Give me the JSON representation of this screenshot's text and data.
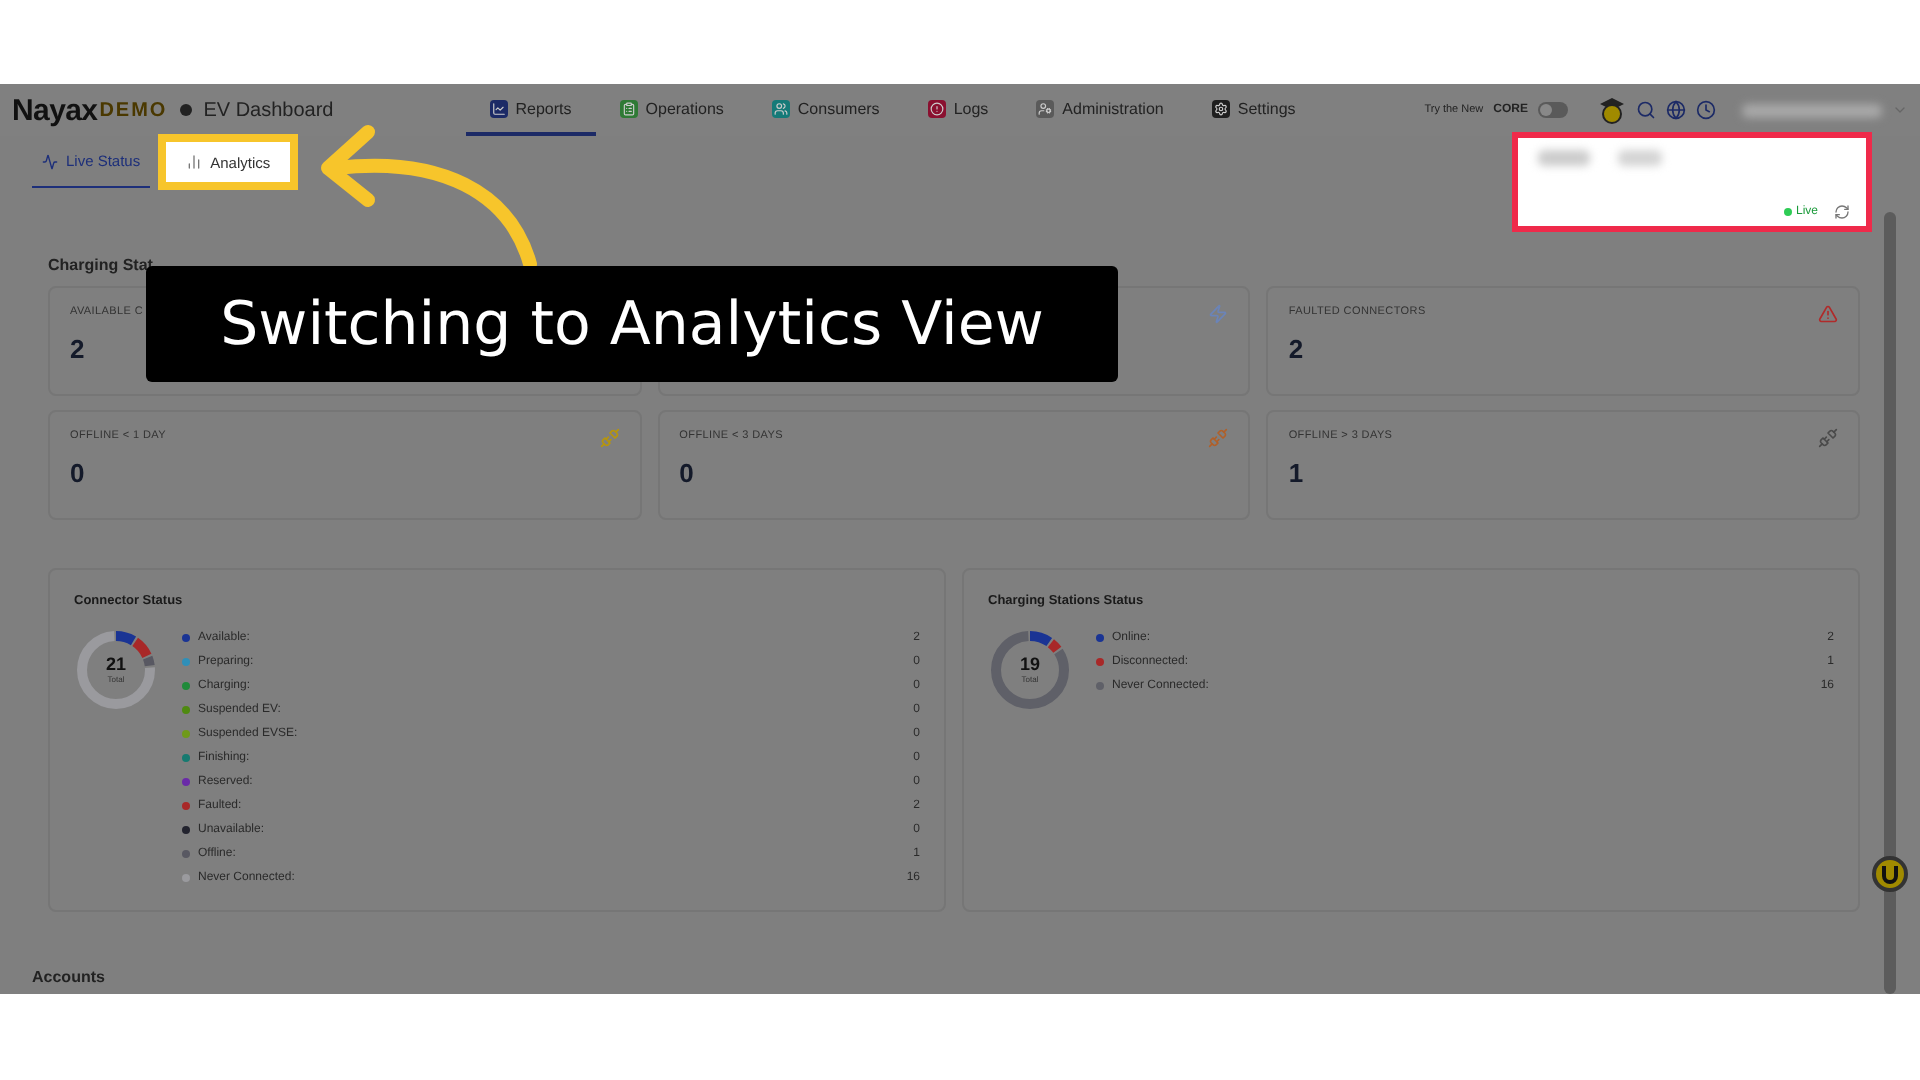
{
  "header": {
    "logo": "Nayax",
    "logo_badge": "DEMO",
    "app_title": "EV Dashboard",
    "nav": [
      {
        "label": "Reports",
        "color": "#1c2a66",
        "selected": true
      },
      {
        "label": "Operations",
        "color": "#2f7a35",
        "selected": false
      },
      {
        "label": "Consumers",
        "color": "#157a78",
        "selected": false
      },
      {
        "label": "Logs",
        "color": "#8a1030",
        "selected": false
      },
      {
        "label": "Administration",
        "color": "#5a5a5a",
        "selected": false
      },
      {
        "label": "Settings",
        "color": "#1e1e1e",
        "selected": false
      }
    ],
    "core_promo": {
      "prefix": "Try the New",
      "brand": "CORE",
      "on": false
    }
  },
  "tabs": [
    {
      "label": "Live Status",
      "selected": true,
      "highlighted": false
    },
    {
      "label": "Analytics",
      "selected": false,
      "highlighted": true
    }
  ],
  "status_panel": {
    "live_label": "Live",
    "highlighted": true
  },
  "section_title": "Charging Stat",
  "cards": [
    {
      "label": "AVAILABLE C",
      "value": "2",
      "kind": "plain"
    },
    {
      "kind": "bolt",
      "color": "#6b84b8"
    },
    {
      "label": "FAULTED CONNECTORS",
      "value": "2",
      "kind": "warning",
      "color": "#b02a2a"
    },
    {
      "label": "OFFLINE < 1 DAY",
      "value": "0",
      "kind": "offline",
      "color": "#b8960a"
    },
    {
      "label": "OFFLINE < 3 DAYS",
      "value": "0",
      "kind": "offline",
      "color": "#b0602a"
    },
    {
      "label": "OFFLINE > 3 DAYS",
      "value": "1",
      "kind": "offline",
      "color": "#4a4a4a"
    }
  ],
  "connector_status": {
    "title": "Connector Status",
    "total": "21",
    "total_label": "Total",
    "items": [
      {
        "label": "Available:",
        "value": "2",
        "color": "#1a3494"
      },
      {
        "label": "Preparing:",
        "value": "0",
        "color": "#2f8fb8"
      },
      {
        "label": "Charging:",
        "value": "0",
        "color": "#1f8a3a"
      },
      {
        "label": "Suspended EV:",
        "value": "0",
        "color": "#4f8a10"
      },
      {
        "label": "Suspended EVSE:",
        "value": "0",
        "color": "#6f9a1a"
      },
      {
        "label": "Finishing:",
        "value": "0",
        "color": "#167a70"
      },
      {
        "label": "Reserved:",
        "value": "0",
        "color": "#6a2aa8"
      },
      {
        "label": "Faulted:",
        "value": "2",
        "color": "#a82828"
      },
      {
        "label": "Unavailable:",
        "value": "0",
        "color": "#22232e"
      },
      {
        "label": "Offline:",
        "value": "1",
        "color": "#585862"
      },
      {
        "label": "Never Connected:",
        "value": "16",
        "color": "#9a9a9e"
      }
    ]
  },
  "stations_status": {
    "title": "Charging Stations Status",
    "total": "19",
    "total_label": "Total",
    "items": [
      {
        "label": "Online:",
        "value": "2",
        "color": "#1a3494"
      },
      {
        "label": "Disconnected:",
        "value": "1",
        "color": "#a82828"
      },
      {
        "label": "Never Connected:",
        "value": "16",
        "color": "#5f6068"
      }
    ]
  },
  "accounts_heading": "Accounts",
  "caption": "Switching to Analytics View"
}
